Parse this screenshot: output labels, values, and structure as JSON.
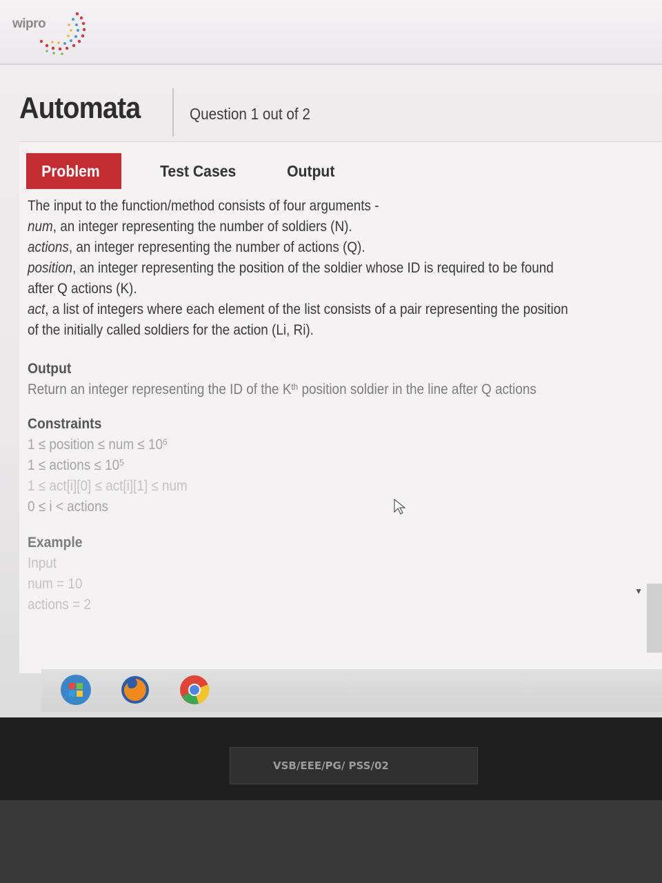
{
  "brand": {
    "logo_text": "wipro"
  },
  "header": {
    "app_title": "Automata",
    "question_count": "Question 1 out of 2"
  },
  "tabs": [
    {
      "label": "Problem",
      "active": true
    },
    {
      "label": "Test Cases",
      "active": false
    },
    {
      "label": "Output",
      "active": false
    }
  ],
  "problem": {
    "intro": "The input to the function/method consists of four arguments -",
    "args": [
      {
        "name": "num",
        "desc": ", an integer representing the number of soldiers (N)."
      },
      {
        "name": "actions",
        "desc": ", an integer representing the number of actions (Q)."
      },
      {
        "name": "position",
        "desc": ", an integer representing the position of the soldier whose ID is required to be found"
      },
      {
        "name": "",
        "desc": "after Q actions (K)."
      },
      {
        "name": "act",
        "desc": ", a list of integers where each element of the list consists of a pair representing the position"
      },
      {
        "name": "",
        "desc": "of the initially called soldiers for the action (Li, Ri)."
      }
    ],
    "output_title": "Output",
    "output_text_a": "Return an integer representing the ID of the K",
    "output_sup": "th",
    "output_text_b": " position soldier in the line after Q actions",
    "constraints_title": "Constraints",
    "constraints": [
      {
        "text": "1 ≤ position ≤ num ≤ 10",
        "sup": "6"
      },
      {
        "text": "1 ≤ actions ≤ 10",
        "sup": "5"
      },
      {
        "text": "1 ≤ act[i][0] ≤ act[i][1] ≤ num",
        "sup": ""
      },
      {
        "text": "0 ≤ i < actions",
        "sup": ""
      }
    ],
    "example_title": "Example",
    "example_lines": [
      "Input",
      "num = 10",
      "actions = 2"
    ]
  },
  "monitor_label": "VSB/EEE/PG/ PSS/02",
  "colors": {
    "active_tab": "#c32d32",
    "text": "#3a3a3a",
    "bezel": "#1f1f1f"
  },
  "taskbar_icons": [
    "windows-start-icon",
    "firefox-icon",
    "chrome-icon"
  ]
}
